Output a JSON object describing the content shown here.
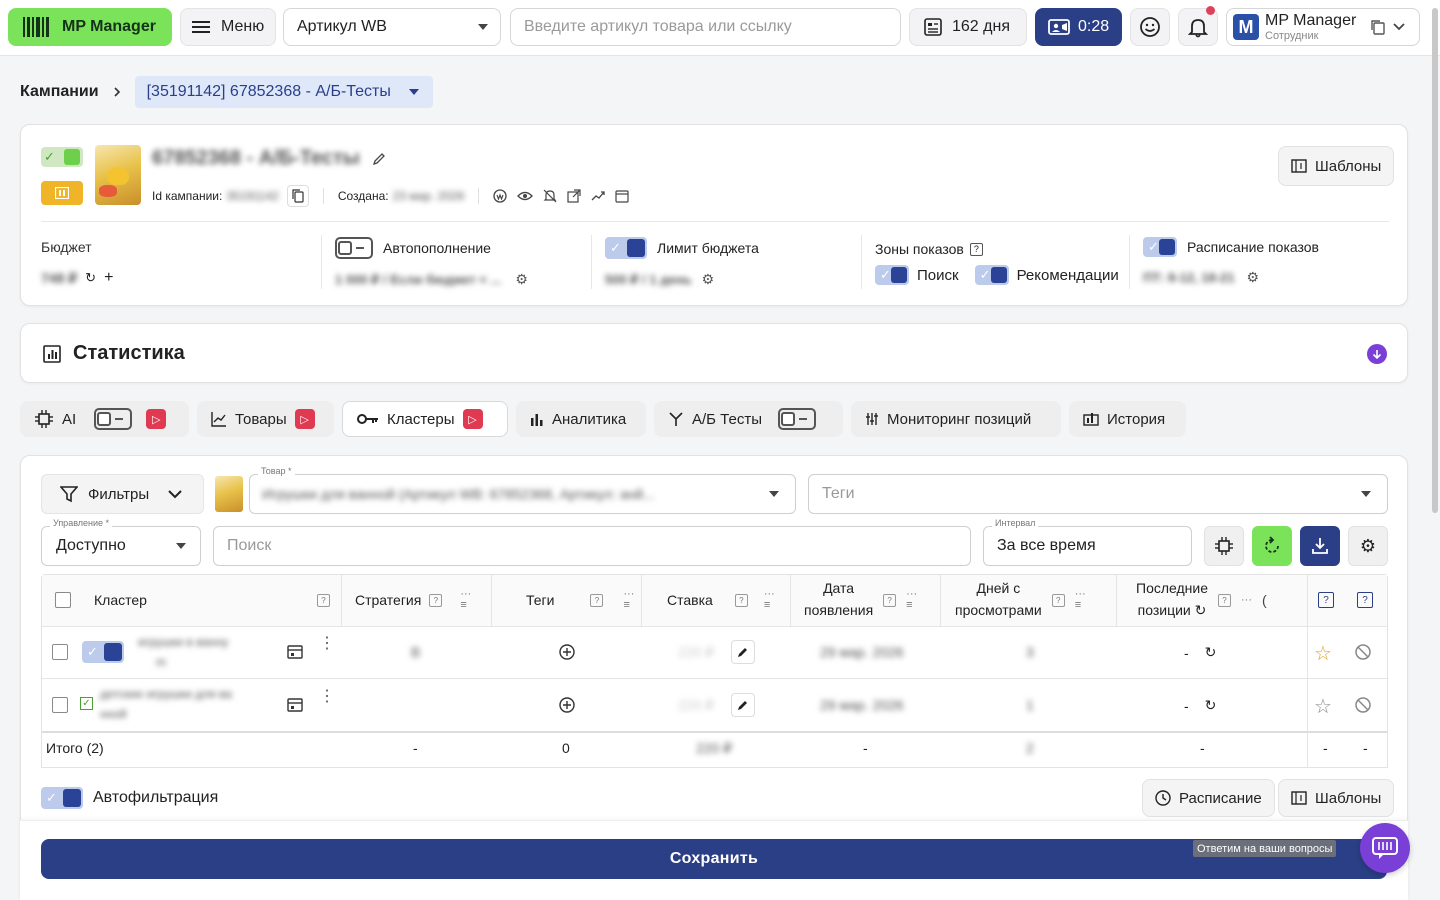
{
  "header": {
    "logo_text": "MP Manager",
    "menu_label": "Меню",
    "article_select": "Артикул WB",
    "search_placeholder": "Введите артикул товара или ссылку",
    "days_label": "162 дня",
    "timer_label": "0:28",
    "user_name": "MP Manager",
    "user_role": "Сотрудник",
    "avatar_letter": "M"
  },
  "breadcrumb": {
    "root": "Кампании",
    "current": "[35191142] 67852368 - А/Б-Тесты"
  },
  "campaign": {
    "name": "67852368 - А/Б-Тесты",
    "id_label": "Id кампании:",
    "id_value": "35191142",
    "created_label": "Создана:",
    "created_value": "23 мар. 2026",
    "templates_label": "Шаблоны",
    "budget_label": "Бюджет",
    "budget_value": "748 ₽",
    "autofill_label": "Автопополнение",
    "autofill_value": "1 000 ₽ / Если бюджет < ...",
    "limit_label": "Лимит бюджета",
    "limit_value": "500 ₽ / 1 день",
    "zones_label": "Зоны показов",
    "zone_search": "Поиск",
    "zone_recs": "Рекомендации",
    "schedule_label": "Расписание показов",
    "schedule_value": "ПТ: 8-12, 18-21"
  },
  "stats": {
    "title": "Статистика"
  },
  "tabs": [
    {
      "label": "AI"
    },
    {
      "label": "Товары"
    },
    {
      "label": "Кластеры"
    },
    {
      "label": "Аналитика"
    },
    {
      "label": "А/Б Тесты"
    },
    {
      "label": "Мониторинг позиций"
    },
    {
      "label": "История"
    }
  ],
  "filters": {
    "filters_label": "Фильтры",
    "product_label": "Товар *",
    "product_value": "Игрушки для ванной (Артикул WB: 67852368, Артикул: анй...",
    "tags_placeholder": "Теги",
    "control_label": "Управление *",
    "control_value": "Доступно",
    "search_placeholder": "Поиск",
    "interval_label": "Интервал",
    "interval_value": "За все время"
  },
  "table": {
    "columns": [
      "Кластер",
      "Стратегия",
      "Теги",
      "Ставка",
      "Дата появления",
      "Дней с просмотрами",
      "Последние позиции"
    ],
    "col_date_1": "Дата",
    "col_date_2": "появления",
    "col_days_1": "Дней с",
    "col_days_2": "просмотрами",
    "col_pos_1": "Последние",
    "col_pos_2": "позиции",
    "rows": [
      {
        "cluster_1": "игрушки в ванну",
        "cluster_2": "m",
        "strategy": "B",
        "bid": "220 ₽",
        "date": "29 мар. 2026",
        "days": "3",
        "positions": "-"
      },
      {
        "cluster_1": "детские игрушки для ва",
        "cluster_2": "нной",
        "strategy": "",
        "bid": "220 ₽",
        "date": "29 мар. 2026",
        "days": "1",
        "positions": "-"
      }
    ],
    "total_label": "Итого (2)",
    "total_strategy": "-",
    "total_tags": "0",
    "total_bid": "220 ₽",
    "total_date": "-",
    "total_days": "2",
    "total_positions": "-",
    "total_a": "-",
    "total_b": "-"
  },
  "footer": {
    "autofilter_label": "Автофильтрация",
    "schedule_btn": "Расписание",
    "templates_btn": "Шаблоны",
    "save_label": "Сохранить",
    "help_text": "Ответим на ваши вопросы"
  },
  "colors": {
    "primary": "#2b3f86",
    "accent_green": "#7be35a",
    "record_red": "#e03a52",
    "purple": "#7a3fd6"
  }
}
